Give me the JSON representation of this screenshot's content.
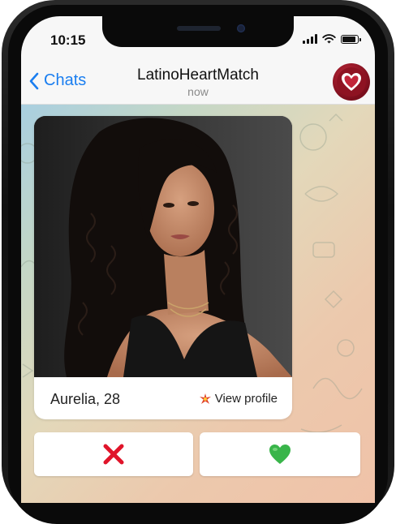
{
  "status_bar": {
    "time": "10:15"
  },
  "header": {
    "back_label": "Chats",
    "title": "LatinoHeartMatch",
    "subtitle": "now"
  },
  "profile_card": {
    "name_age": "Aurelia, 28",
    "view_profile_label": "View profile"
  },
  "actions": {
    "dislike_icon": "red-cross",
    "like_icon": "green-heart"
  },
  "colors": {
    "link_blue": "#1a7ef0",
    "brand_red": "#a61b2c",
    "dislike_red": "#e0142a",
    "like_green": "#39b54a"
  }
}
